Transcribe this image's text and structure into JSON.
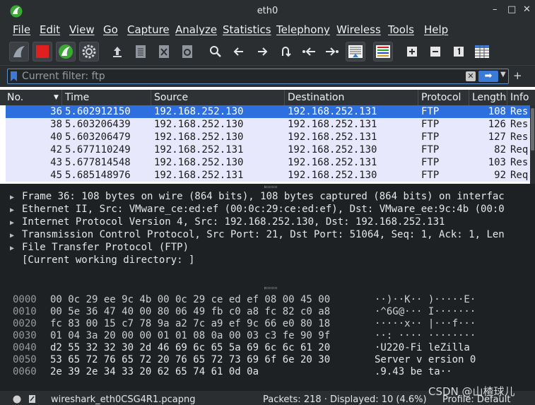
{
  "window": {
    "title": "eth0",
    "minimize": "–",
    "maximize": "□",
    "close": "✕"
  },
  "menu": [
    "File",
    "Edit",
    "View",
    "Go",
    "Capture",
    "Analyze",
    "Statistics",
    "Telephony",
    "Wireless",
    "Tools",
    "Help"
  ],
  "filter": {
    "placeholder": "Current filter: ftp",
    "clear": "✕",
    "apply": "➡",
    "plus": "+"
  },
  "columns": [
    "No.",
    "Time",
    "Source",
    "Destination",
    "Protocol",
    "Length",
    "Info"
  ],
  "packets": [
    {
      "no": "36",
      "time": "5.602912150",
      "src": "192.168.252.130",
      "dst": "192.168.252.131",
      "proto": "FTP",
      "len": "108",
      "info": "Res"
    },
    {
      "no": "38",
      "time": "5.603206439",
      "src": "192.168.252.130",
      "dst": "192.168.252.131",
      "proto": "FTP",
      "len": "126",
      "info": "Res"
    },
    {
      "no": "40",
      "time": "5.603206479",
      "src": "192.168.252.130",
      "dst": "192.168.252.131",
      "proto": "FTP",
      "len": "127",
      "info": "Res"
    },
    {
      "no": "42",
      "time": "5.677110249",
      "src": "192.168.252.131",
      "dst": "192.168.252.130",
      "proto": "FTP",
      "len": "82",
      "info": "Req"
    },
    {
      "no": "43",
      "time": "5.677814548",
      "src": "192.168.252.130",
      "dst": "192.168.252.131",
      "proto": "FTP",
      "len": "103",
      "info": "Res"
    },
    {
      "no": "45",
      "time": "5.685148976",
      "src": "192.168.252.131",
      "dst": "192.168.252.130",
      "proto": "FTP",
      "len": "92",
      "info": "Req"
    }
  ],
  "details": [
    "Frame 36: 108 bytes on wire (864 bits), 108 bytes captured (864 bits) on interfac",
    "Ethernet II, Src: VMware_ce:ed:ef (00:0c:29:ce:ed:ef), Dst: VMware_ee:9c:4b (00:0",
    "Internet Protocol Version 4, Src: 192.168.252.130, Dst: 192.168.252.131",
    "Transmission Control Protocol, Src Port: 21, Dst Port: 51064, Seq: 1, Ack: 1, Len",
    "File Transfer Protocol (FTP)",
    "[Current working directory: ]"
  ],
  "bytes": [
    {
      "off": "0000",
      "hex": "00 0c 29 ee 9c 4b 00 0c  29 ce ed ef 08 00 45 00",
      "asc": "··)··K·· )·····E·"
    },
    {
      "off": "0010",
      "hex": "00 5e 36 47 40 00 80 06  49 fb c0 a8 fc 82 c0 a8",
      "asc": "·^6G@··· I·······"
    },
    {
      "off": "0020",
      "hex": "fc 83 00 15 c7 78 9a a2  7c a9 ef 9c 66 e0 80 18",
      "asc": "·····x·· |···f···"
    },
    {
      "off": "0030",
      "hex": "01 04 3a 20 00 00 01 01  08 0a 00 03 c3 fe 90 9f",
      "asc": "··: ···· ········"
    },
    {
      "off": "0040",
      "hex": "d2 55 32 32 30 2d 46 69  6c 65 5a 69 6c 6c 61 20",
      "asc": "·U220-Fi leZilla "
    },
    {
      "off": "0050",
      "hex": "53 65 72 76 65 72 20 76  65 72 73 69 6f 6e 20 30",
      "asc": "Server v ersion 0"
    },
    {
      "off": "0060",
      "hex": "2e 39 2e 34 33 20 62 65  74 61 0d 0a",
      "asc": ".9.43 be ta··"
    }
  ],
  "status": {
    "file": "wireshark_eth0CSG4R1.pcapng",
    "packets": "Packets: 218 · Displayed: 10 (4.6%)",
    "profile": "Profile: Default"
  },
  "watermark": "CSDN @山楂球儿",
  "colors": {
    "selected_row": "#2e6fe0",
    "ftp_row": "#e8e8fd",
    "accent": "#3b7ad6",
    "stop": "#e02020",
    "shark_green": "#3aaa35"
  }
}
